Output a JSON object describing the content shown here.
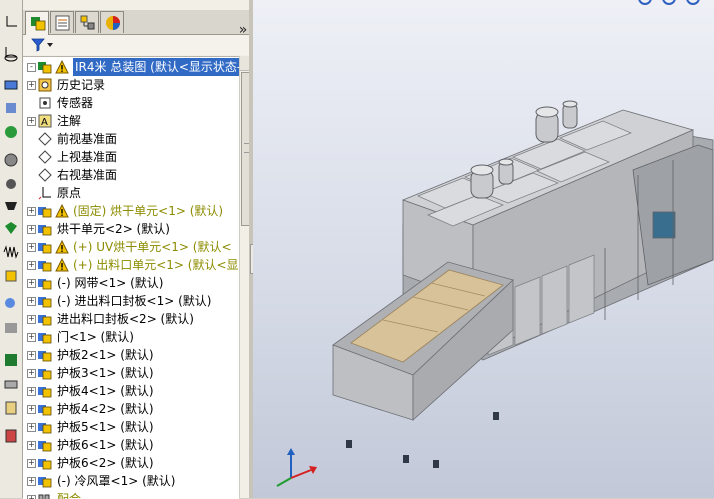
{
  "panel": {
    "expand_label": "»",
    "tabs": [
      {
        "name": "featuremanager-tab",
        "icon": "featuremanager-icon"
      },
      {
        "name": "propertymanager-tab",
        "icon": "propertymanager-icon"
      },
      {
        "name": "configurationmanager-tab",
        "icon": "configuration-icon"
      },
      {
        "name": "appearance-tab",
        "icon": "appearance-icon"
      }
    ],
    "filter_icon": "filter-icon"
  },
  "tree": {
    "items": [
      {
        "label": "IR4米 总装图  (默认<显示状态-",
        "icon": "assembly-icon",
        "warn": true,
        "selected": true,
        "yellow": false,
        "expander": "-"
      },
      {
        "label": "历史记录",
        "icon": "history-icon",
        "warn": false,
        "yellow": false,
        "expander": "+"
      },
      {
        "label": "传感器",
        "icon": "sensor-icon",
        "warn": false,
        "yellow": false,
        "expander": ""
      },
      {
        "label": "注解",
        "icon": "annotation-icon",
        "warn": false,
        "yellow": false,
        "expander": "+"
      },
      {
        "label": "前视基准面",
        "icon": "plane-icon",
        "warn": false,
        "yellow": false,
        "expander": ""
      },
      {
        "label": "上视基准面",
        "icon": "plane-icon",
        "warn": false,
        "yellow": false,
        "expander": ""
      },
      {
        "label": "右视基准面",
        "icon": "plane-icon",
        "warn": false,
        "yellow": false,
        "expander": ""
      },
      {
        "label": "原点",
        "icon": "origin-icon",
        "warn": false,
        "yellow": false,
        "expander": ""
      },
      {
        "label": "(固定) 烘干单元<1> (默认)",
        "icon": "subassembly-icon",
        "warn": true,
        "yellow": true,
        "expander": "+"
      },
      {
        "label": "烘干单元<2> (默认)",
        "icon": "subassembly-icon",
        "warn": false,
        "yellow": false,
        "expander": "+"
      },
      {
        "label": "(+) UV烘干单元<1> (默认<",
        "icon": "subassembly-icon",
        "warn": true,
        "yellow": true,
        "expander": "+"
      },
      {
        "label": "(+) 出料口单元<1> (默认<显",
        "icon": "subassembly-icon",
        "warn": true,
        "yellow": true,
        "expander": "+"
      },
      {
        "label": "(-) 网带<1> (默认)",
        "icon": "subassembly-icon",
        "warn": false,
        "yellow": false,
        "expander": "+"
      },
      {
        "label": "(-) 进出料口封板<1> (默认)",
        "icon": "subassembly-icon",
        "warn": false,
        "yellow": false,
        "expander": "+"
      },
      {
        "label": "进出料口封板<2> (默认)",
        "icon": "subassembly-icon",
        "warn": false,
        "yellow": false,
        "expander": "+"
      },
      {
        "label": "门<1> (默认)",
        "icon": "subassembly-icon",
        "warn": false,
        "yellow": false,
        "expander": "+"
      },
      {
        "label": "护板2<1> (默认)",
        "icon": "subassembly-icon",
        "warn": false,
        "yellow": false,
        "expander": "+"
      },
      {
        "label": "护板3<1> (默认)",
        "icon": "subassembly-icon",
        "warn": false,
        "yellow": false,
        "expander": "+"
      },
      {
        "label": "护板4<1> (默认)",
        "icon": "subassembly-icon",
        "warn": false,
        "yellow": false,
        "expander": "+"
      },
      {
        "label": "护板4<2> (默认)",
        "icon": "subassembly-icon",
        "warn": false,
        "yellow": false,
        "expander": "+"
      },
      {
        "label": "护板5<1> (默认)",
        "icon": "subassembly-icon",
        "warn": false,
        "yellow": false,
        "expander": "+"
      },
      {
        "label": "护板6<1> (默认)",
        "icon": "subassembly-icon",
        "warn": false,
        "yellow": false,
        "expander": "+"
      },
      {
        "label": "护板6<2> (默认)",
        "icon": "subassembly-icon",
        "warn": false,
        "yellow": false,
        "expander": "+"
      },
      {
        "label": "(-) 冷风罩<1> (默认)",
        "icon": "subassembly-icon",
        "warn": false,
        "yellow": false,
        "expander": "+"
      },
      {
        "label": "配合",
        "icon": "mates-icon",
        "warn": false,
        "yellow": true,
        "expander": "+"
      }
    ]
  },
  "left_toolbar": {
    "icons": [
      "origin-axis-icon",
      "sketch-line-icon",
      "dimension-icon",
      "monitor-icon",
      "assembly-tools-icon",
      "globe-icon",
      "settings-gear-icon",
      "gear-icon",
      "hole-icon",
      "green-shield-icon",
      "spring-icon",
      "yellow-block-icon",
      "search-magnifier-icon",
      "library-icon",
      "excel-icon",
      "printer-icon",
      "report-icon",
      "calculator-icon"
    ]
  },
  "viewport": {
    "view_icons": [
      "zoom-fit-icon",
      "zoom-area-icon",
      "rotate-view-icon"
    ],
    "colors": {
      "frame": "#b6b8bc",
      "belt": "#d8c29a",
      "dark": "#2f3846",
      "motor": "#3a6e8e"
    }
  }
}
